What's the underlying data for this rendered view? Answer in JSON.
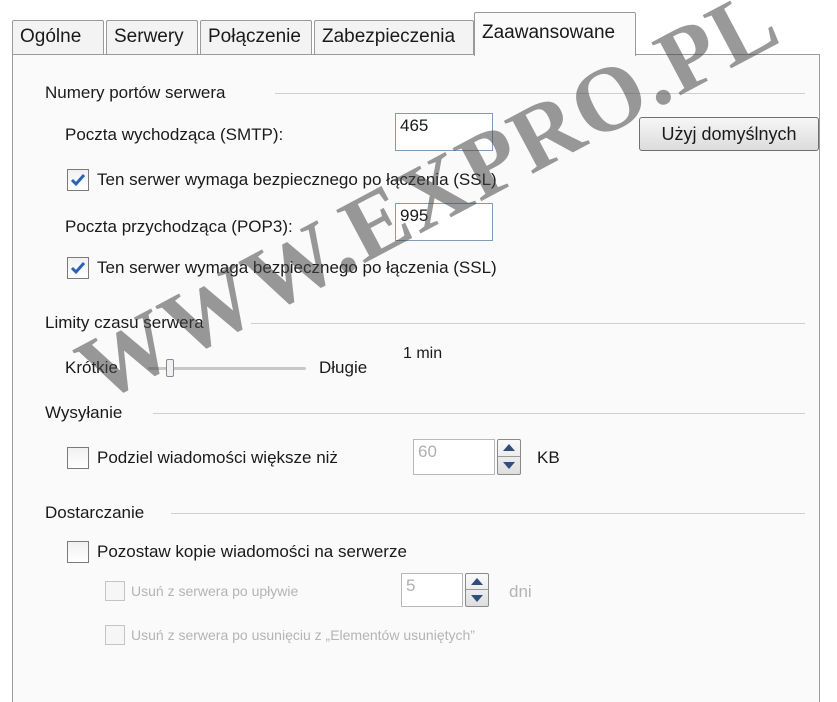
{
  "tabs": [
    {
      "label": "Ogólne"
    },
    {
      "label": "Serwery"
    },
    {
      "label": "Połączenie"
    },
    {
      "label": "Zabezpieczenia"
    },
    {
      "label": "Zaawansowane",
      "active": true
    }
  ],
  "server_ports": {
    "title": "Numery portów serwera",
    "smtp_label": "Poczta wychodząca (SMTP):",
    "smtp_value": "465",
    "smtp_ssl_label": "Ten serwer wymaga bezpiecznego po łączenia (SSL)",
    "smtp_ssl_checked": true,
    "pop3_label": "Poczta przychodząca (POP3):",
    "pop3_value": "995",
    "pop3_ssl_label": "Ten serwer wymaga bezpiecznego po łączenia (SSL)",
    "pop3_ssl_checked": true,
    "default_button": "Użyj domyślnych"
  },
  "timeouts": {
    "title": "Limity czasu serwera",
    "short_label": "Krótkie",
    "long_label": "Długie",
    "value_label": "1 min",
    "slider_level": 0.15
  },
  "sending": {
    "title": "Wysyłanie",
    "split_label": "Podziel wiadomości większe niż",
    "split_checked": false,
    "split_value": "60",
    "unit": "KB"
  },
  "delivery": {
    "title": "Dostarczanie",
    "leave_copy_label": "Pozostaw kopie wiadomości na serwerze",
    "leave_copy_checked": false,
    "remove_after_label": "Usuń z serwera po upływie",
    "remove_after_value": "5",
    "remove_after_unit": "dni",
    "remove_deleted_label": "Usuń z serwera po usunięciu z „Elementów usuniętych”"
  },
  "watermark": "WWW.EXPRO.PL",
  "icons": {
    "checkmark": "check-icon",
    "spin_up": "arrow-up-icon",
    "spin_down": "arrow-down-icon"
  },
  "colors": {
    "checkmark": "#2a62b6",
    "field_border": "#7f9db9",
    "disabled_text": "#b4b4b4"
  }
}
